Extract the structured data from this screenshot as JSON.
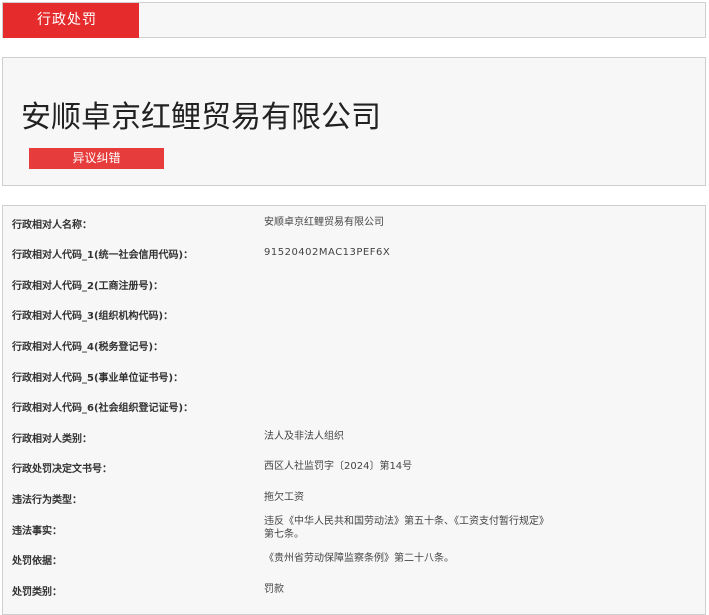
{
  "tab": {
    "active_label": "行政处罚"
  },
  "header": {
    "company_name": "安顺卓京红鲤贸易有限公司",
    "dispute_button_label": "异议纠错"
  },
  "details": [
    {
      "label": "行政相对人名称：",
      "value": "安顺卓京红鲤贸易有限公司"
    },
    {
      "label": "行政相对人代码_1(统一社会信用代码)：",
      "value": "91520402MAC13PEF6X"
    },
    {
      "label": "行政相对人代码_2(工商注册号)：",
      "value": ""
    },
    {
      "label": "行政相对人代码_3(组织机构代码)：",
      "value": ""
    },
    {
      "label": "行政相对人代码_4(税务登记号)：",
      "value": ""
    },
    {
      "label": "行政相对人代码_5(事业单位证书号)：",
      "value": ""
    },
    {
      "label": "行政相对人代码_6(社会组织登记证号)：",
      "value": ""
    },
    {
      "label": "行政相对人类别：",
      "value": "法人及非法人组织"
    },
    {
      "label": "行政处罚决定文书号：",
      "value": "西区人社监罚字〔2024〕第14号"
    },
    {
      "label": "违法行为类型：",
      "value": "拖欠工资"
    },
    {
      "label": "违法事实：",
      "value": "违反《中华人民共和国劳动法》第五十条、《工资支付暂行规定》第七条。"
    },
    {
      "label": "处罚依据：",
      "value": "《贵州省劳动保障监察条例》第二十八条。"
    },
    {
      "label": "处罚类别：",
      "value": "罚款"
    }
  ]
}
